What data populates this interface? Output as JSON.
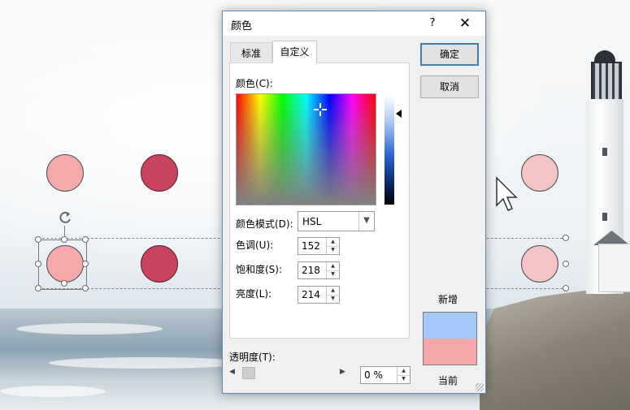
{
  "dialog": {
    "title": "颜色",
    "help_label": "?",
    "close_label": "✕",
    "tabs": [
      {
        "label": "标准",
        "active": false
      },
      {
        "label": "自定义",
        "active": true
      }
    ],
    "colors_label": "颜色(C):",
    "color_mode_label": "颜色模式(D):",
    "color_mode_value": "HSL",
    "fields": [
      {
        "label": "色调(U):",
        "value": "152"
      },
      {
        "label": "饱和度(S):",
        "value": "218"
      },
      {
        "label": "亮度(L):",
        "value": "214"
      }
    ],
    "transparency_label": "透明度(T):",
    "transparency_value": "0 %",
    "transparency_fraction": 0,
    "ok_label": "确定",
    "cancel_label": "取消",
    "new_label": "新增",
    "current_label": "当前",
    "colors": {
      "new": "#a6c8f8",
      "current": "#f5a7a7",
      "ok_border": "#3c7fb1",
      "dialog_border": "#5a8cc2"
    }
  },
  "slide": {
    "shape_colors": {
      "pink": "#f7a9aa",
      "red": "#c8435d",
      "pale": "#f4c3c3"
    }
  },
  "icons": {
    "rotate": "rotate-handle-icon",
    "cursor": "mouse-pointer-icon",
    "crosshair": "crosshair-icon",
    "dropdown": "chevron-down-icon",
    "spin_up": "spin-up-icon",
    "spin_down": "spin-down-icon"
  }
}
